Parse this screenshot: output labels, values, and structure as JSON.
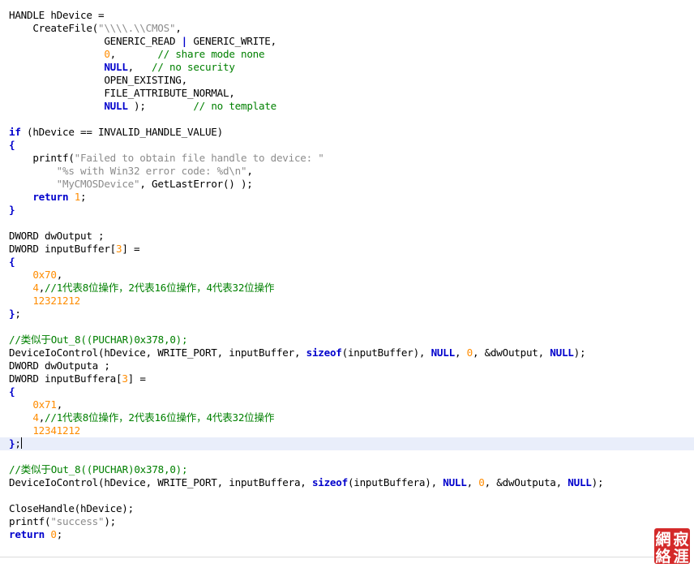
{
  "colors": {
    "keyword": "#0000cc",
    "string": "#8c8c8c",
    "number": "#ff8c00",
    "comment": "#008000",
    "plain": "#000000",
    "current_line": "#e9eefa",
    "seal": "#d42a2a"
  },
  "editor": {
    "current_line_index": 33,
    "lines": [
      [
        [
          "pl",
          "HANDLE hDevice ="
        ]
      ],
      [
        [
          "pl",
          "    CreateFile("
        ],
        [
          "str",
          "\"\\\\\\\\.\\\\CMOS\""
        ],
        [
          "pl",
          ","
        ]
      ],
      [
        [
          "pl",
          "                GENERIC_READ "
        ],
        [
          "op",
          "|"
        ],
        [
          "pl",
          " GENERIC_WRITE,"
        ]
      ],
      [
        [
          "pl",
          "                "
        ],
        [
          "num",
          "0"
        ],
        [
          "pl",
          ",       "
        ],
        [
          "cm",
          "// share mode none"
        ]
      ],
      [
        [
          "pl",
          "                "
        ],
        [
          "kw",
          "NULL"
        ],
        [
          "pl",
          ",   "
        ],
        [
          "cm",
          "// no security"
        ]
      ],
      [
        [
          "pl",
          "                OPEN_EXISTING,"
        ]
      ],
      [
        [
          "pl",
          "                FILE_ATTRIBUTE_NORMAL,"
        ]
      ],
      [
        [
          "pl",
          "                "
        ],
        [
          "kw",
          "NULL"
        ],
        [
          "pl",
          " );        "
        ],
        [
          "cm",
          "// no template"
        ]
      ],
      [],
      [
        [
          "kw",
          "if"
        ],
        [
          "pl",
          " (hDevice == INVALID_HANDLE_VALUE)"
        ]
      ],
      [
        [
          "op",
          "{"
        ]
      ],
      [
        [
          "pl",
          "    printf("
        ],
        [
          "str",
          "\"Failed to obtain file handle to device: \""
        ]
      ],
      [
        [
          "pl",
          "        "
        ],
        [
          "str",
          "\"%s with Win32 error code: %d\\n\""
        ],
        [
          "pl",
          ","
        ]
      ],
      [
        [
          "pl",
          "        "
        ],
        [
          "str",
          "\"MyCMOSDevice\""
        ],
        [
          "pl",
          ", GetLastError() );"
        ]
      ],
      [
        [
          "pl",
          "    "
        ],
        [
          "kw",
          "return"
        ],
        [
          "pl",
          " "
        ],
        [
          "num",
          "1"
        ],
        [
          "pl",
          ";"
        ]
      ],
      [
        [
          "op",
          "}"
        ]
      ],
      [],
      [
        [
          "pl",
          "DWORD dwOutput ;"
        ]
      ],
      [
        [
          "pl",
          "DWORD inputBuffer["
        ],
        [
          "num",
          "3"
        ],
        [
          "pl",
          "] ="
        ]
      ],
      [
        [
          "op",
          "{"
        ]
      ],
      [
        [
          "pl",
          "    "
        ],
        [
          "num",
          "0x70"
        ],
        [
          "pl",
          ","
        ]
      ],
      [
        [
          "pl",
          "    "
        ],
        [
          "num",
          "4"
        ],
        [
          "pl",
          ","
        ],
        [
          "cm",
          "//1代表8位操作，2代表16位操作，4代表32位操作"
        ]
      ],
      [
        [
          "pl",
          "    "
        ],
        [
          "num",
          "12321212"
        ]
      ],
      [
        [
          "op",
          "}"
        ],
        [
          "pl",
          ";"
        ]
      ],
      [],
      [
        [
          "cm",
          "//类似于Out_8((PUCHAR)0x378,0);"
        ]
      ],
      [
        [
          "pl",
          "DeviceIoControl(hDevice, WRITE_PORT, inputBuffer, "
        ],
        [
          "kw",
          "sizeof"
        ],
        [
          "pl",
          "(inputBuffer), "
        ],
        [
          "kw",
          "NULL"
        ],
        [
          "pl",
          ", "
        ],
        [
          "num",
          "0"
        ],
        [
          "pl",
          ", &dwOutput, "
        ],
        [
          "kw",
          "NULL"
        ],
        [
          "pl",
          ");"
        ]
      ],
      [
        [
          "pl",
          "DWORD dwOutputa ;"
        ]
      ],
      [
        [
          "pl",
          "DWORD inputBuffera["
        ],
        [
          "num",
          "3"
        ],
        [
          "pl",
          "] ="
        ]
      ],
      [
        [
          "op",
          "{"
        ]
      ],
      [
        [
          "pl",
          "    "
        ],
        [
          "num",
          "0x71"
        ],
        [
          "pl",
          ","
        ]
      ],
      [
        [
          "pl",
          "    "
        ],
        [
          "num",
          "4"
        ],
        [
          "pl",
          ","
        ],
        [
          "cm",
          "//1代表8位操作，2代表16位操作，4代表32位操作"
        ]
      ],
      [
        [
          "pl",
          "    "
        ],
        [
          "num",
          "12341212"
        ]
      ],
      [
        [
          "op",
          "}"
        ],
        [
          "pl",
          ";"
        ]
      ],
      [],
      [
        [
          "cm",
          "//类似于Out_8((PUCHAR)0x378,0);"
        ]
      ],
      [
        [
          "pl",
          "DeviceIoControl(hDevice, WRITE_PORT, inputBuffera, "
        ],
        [
          "kw",
          "sizeof"
        ],
        [
          "pl",
          "(inputBuffera), "
        ],
        [
          "kw",
          "NULL"
        ],
        [
          "pl",
          ", "
        ],
        [
          "num",
          "0"
        ],
        [
          "pl",
          ", &dwOutputa, "
        ],
        [
          "kw",
          "NULL"
        ],
        [
          "pl",
          ");"
        ]
      ],
      [],
      [
        [
          "pl",
          "CloseHandle(hDevice);"
        ]
      ],
      [
        [
          "pl",
          "printf("
        ],
        [
          "str",
          "\"success\""
        ],
        [
          "pl",
          ");"
        ]
      ],
      [
        [
          "kw",
          "return"
        ],
        [
          "pl",
          " "
        ],
        [
          "num",
          "0"
        ],
        [
          "pl",
          ";"
        ]
      ]
    ]
  },
  "watermark": {
    "chars": [
      "寂",
      "涯",
      "網",
      "絡"
    ]
  }
}
